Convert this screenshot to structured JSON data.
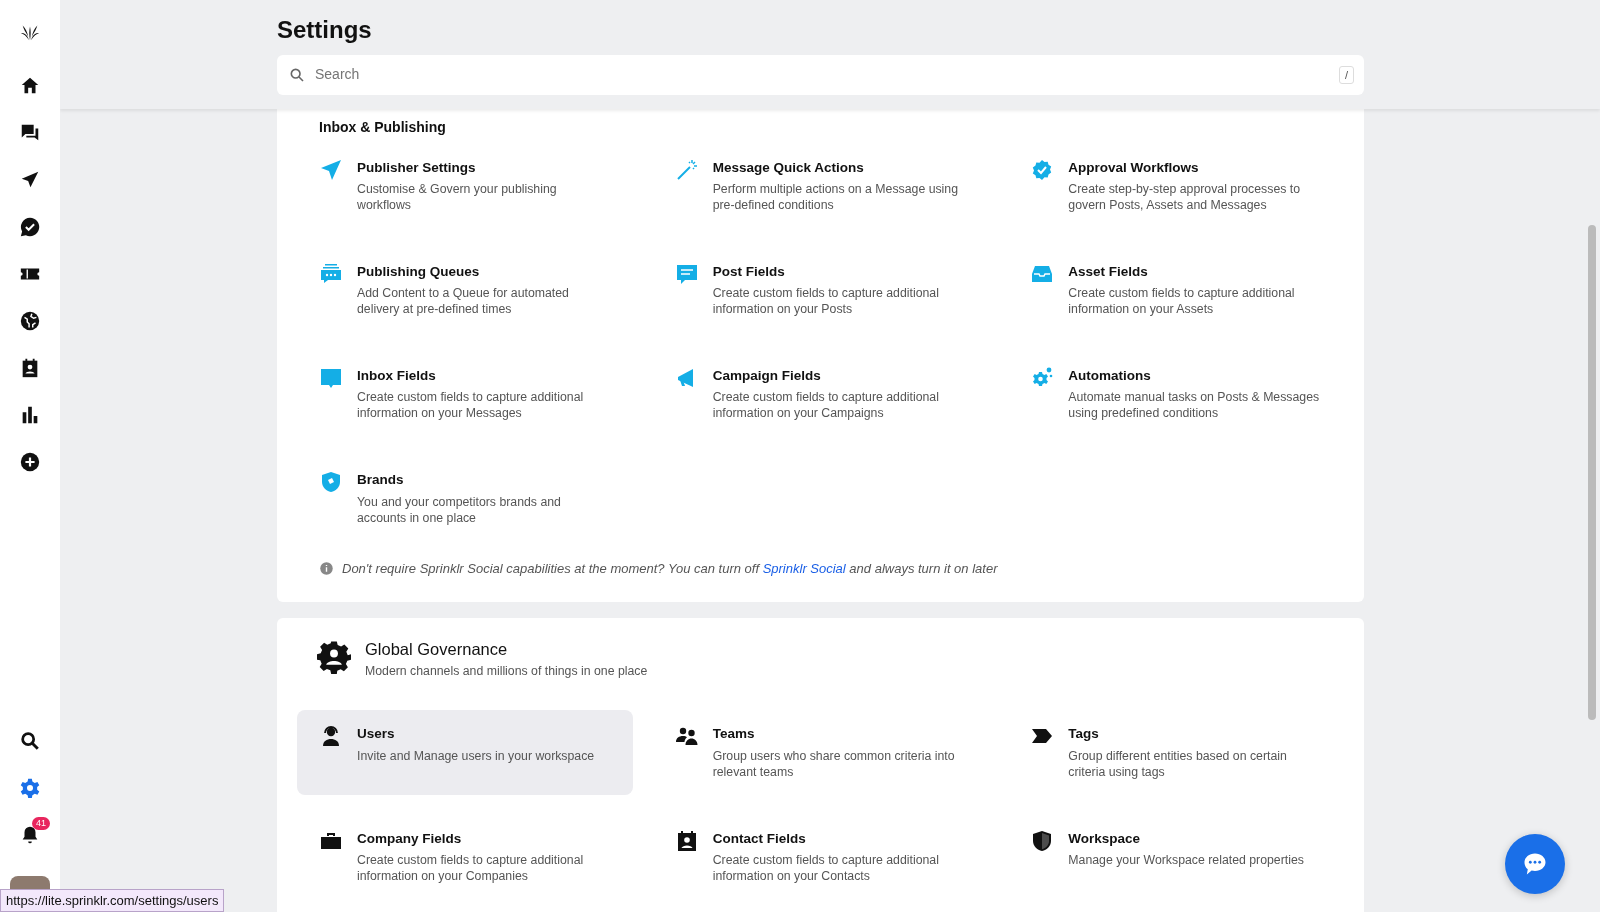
{
  "sidebar": {
    "nav_items": [
      {
        "selected": false
      },
      {
        "selected": false
      },
      {
        "selected": false
      },
      {
        "selected": false
      },
      {
        "selected": false
      },
      {
        "selected": false
      },
      {
        "selected": false
      },
      {
        "selected": false
      },
      {
        "selected": false
      }
    ],
    "bottom_items": [
      {
        "selected": false
      },
      {
        "selected": true
      }
    ],
    "notifications": {
      "badge": "41"
    }
  },
  "header": {
    "title": "Settings",
    "search": {
      "placeholder": "Search",
      "shortcut": "/"
    }
  },
  "sections": [
    {
      "kind": "plain",
      "title": "Inbox & Publishing",
      "items": [
        {
          "title": "Publisher Settings",
          "description": "Customise & Govern your publishing workflows",
          "hovered": false
        },
        {
          "title": "Message Quick Actions",
          "description": "Perform multiple actions on a Message using pre-defined conditions",
          "hovered": false
        },
        {
          "title": "Approval Workflows",
          "description": "Create step-by-step approval processes to govern Posts, Assets and Messages",
          "hovered": false
        },
        {
          "title": "Publishing Queues",
          "description": "Add Content to a Queue for automated delivery at pre-defined times",
          "hovered": false
        },
        {
          "title": "Post Fields",
          "description": "Create custom fields to capture additional information on your Posts",
          "hovered": false
        },
        {
          "title": "Asset Fields",
          "description": "Create custom fields to capture additional information on your Assets",
          "hovered": false
        },
        {
          "title": "Inbox Fields",
          "description": "Create custom fields to capture additional information on your Messages",
          "hovered": false
        },
        {
          "title": "Campaign Fields",
          "description": "Create custom fields to capture additional information on your Campaigns",
          "hovered": false
        },
        {
          "title": "Automations",
          "description": "Automate manual tasks on Posts & Messages using predefined conditions",
          "hovered": false
        },
        {
          "title": "Brands",
          "description": "You and your competitors brands and accounts in one place",
          "hovered": false
        }
      ],
      "note": {
        "text_before": "Don't require Sprinklr Social capabilities at the moment? You can turn off",
        "link": "Sprinklr Social",
        "text_after": "and always turn it on later"
      }
    },
    {
      "kind": "header",
      "title": "Global Governance",
      "subtitle": "Modern channels and millions of things in one place",
      "items": [
        {
          "title": "Users",
          "description": "Invite and Manage users in your workspace",
          "hovered": true
        },
        {
          "title": "Teams",
          "description": "Group users who share common criteria into relevant teams",
          "hovered": false
        },
        {
          "title": "Tags",
          "description": "Group different entities based on certain criteria using tags",
          "hovered": false
        },
        {
          "title": "Company Fields",
          "description": "Create custom fields to capture additional information on your Companies",
          "hovered": false
        },
        {
          "title": "Contact Fields",
          "description": "Create custom fields to capture additional information on your Contacts",
          "hovered": false
        },
        {
          "title": "Workspace",
          "description": "Manage your Workspace related properties",
          "hovered": false
        }
      ]
    }
  ],
  "status_url": "https://lite.sprinklr.com/settings/users"
}
